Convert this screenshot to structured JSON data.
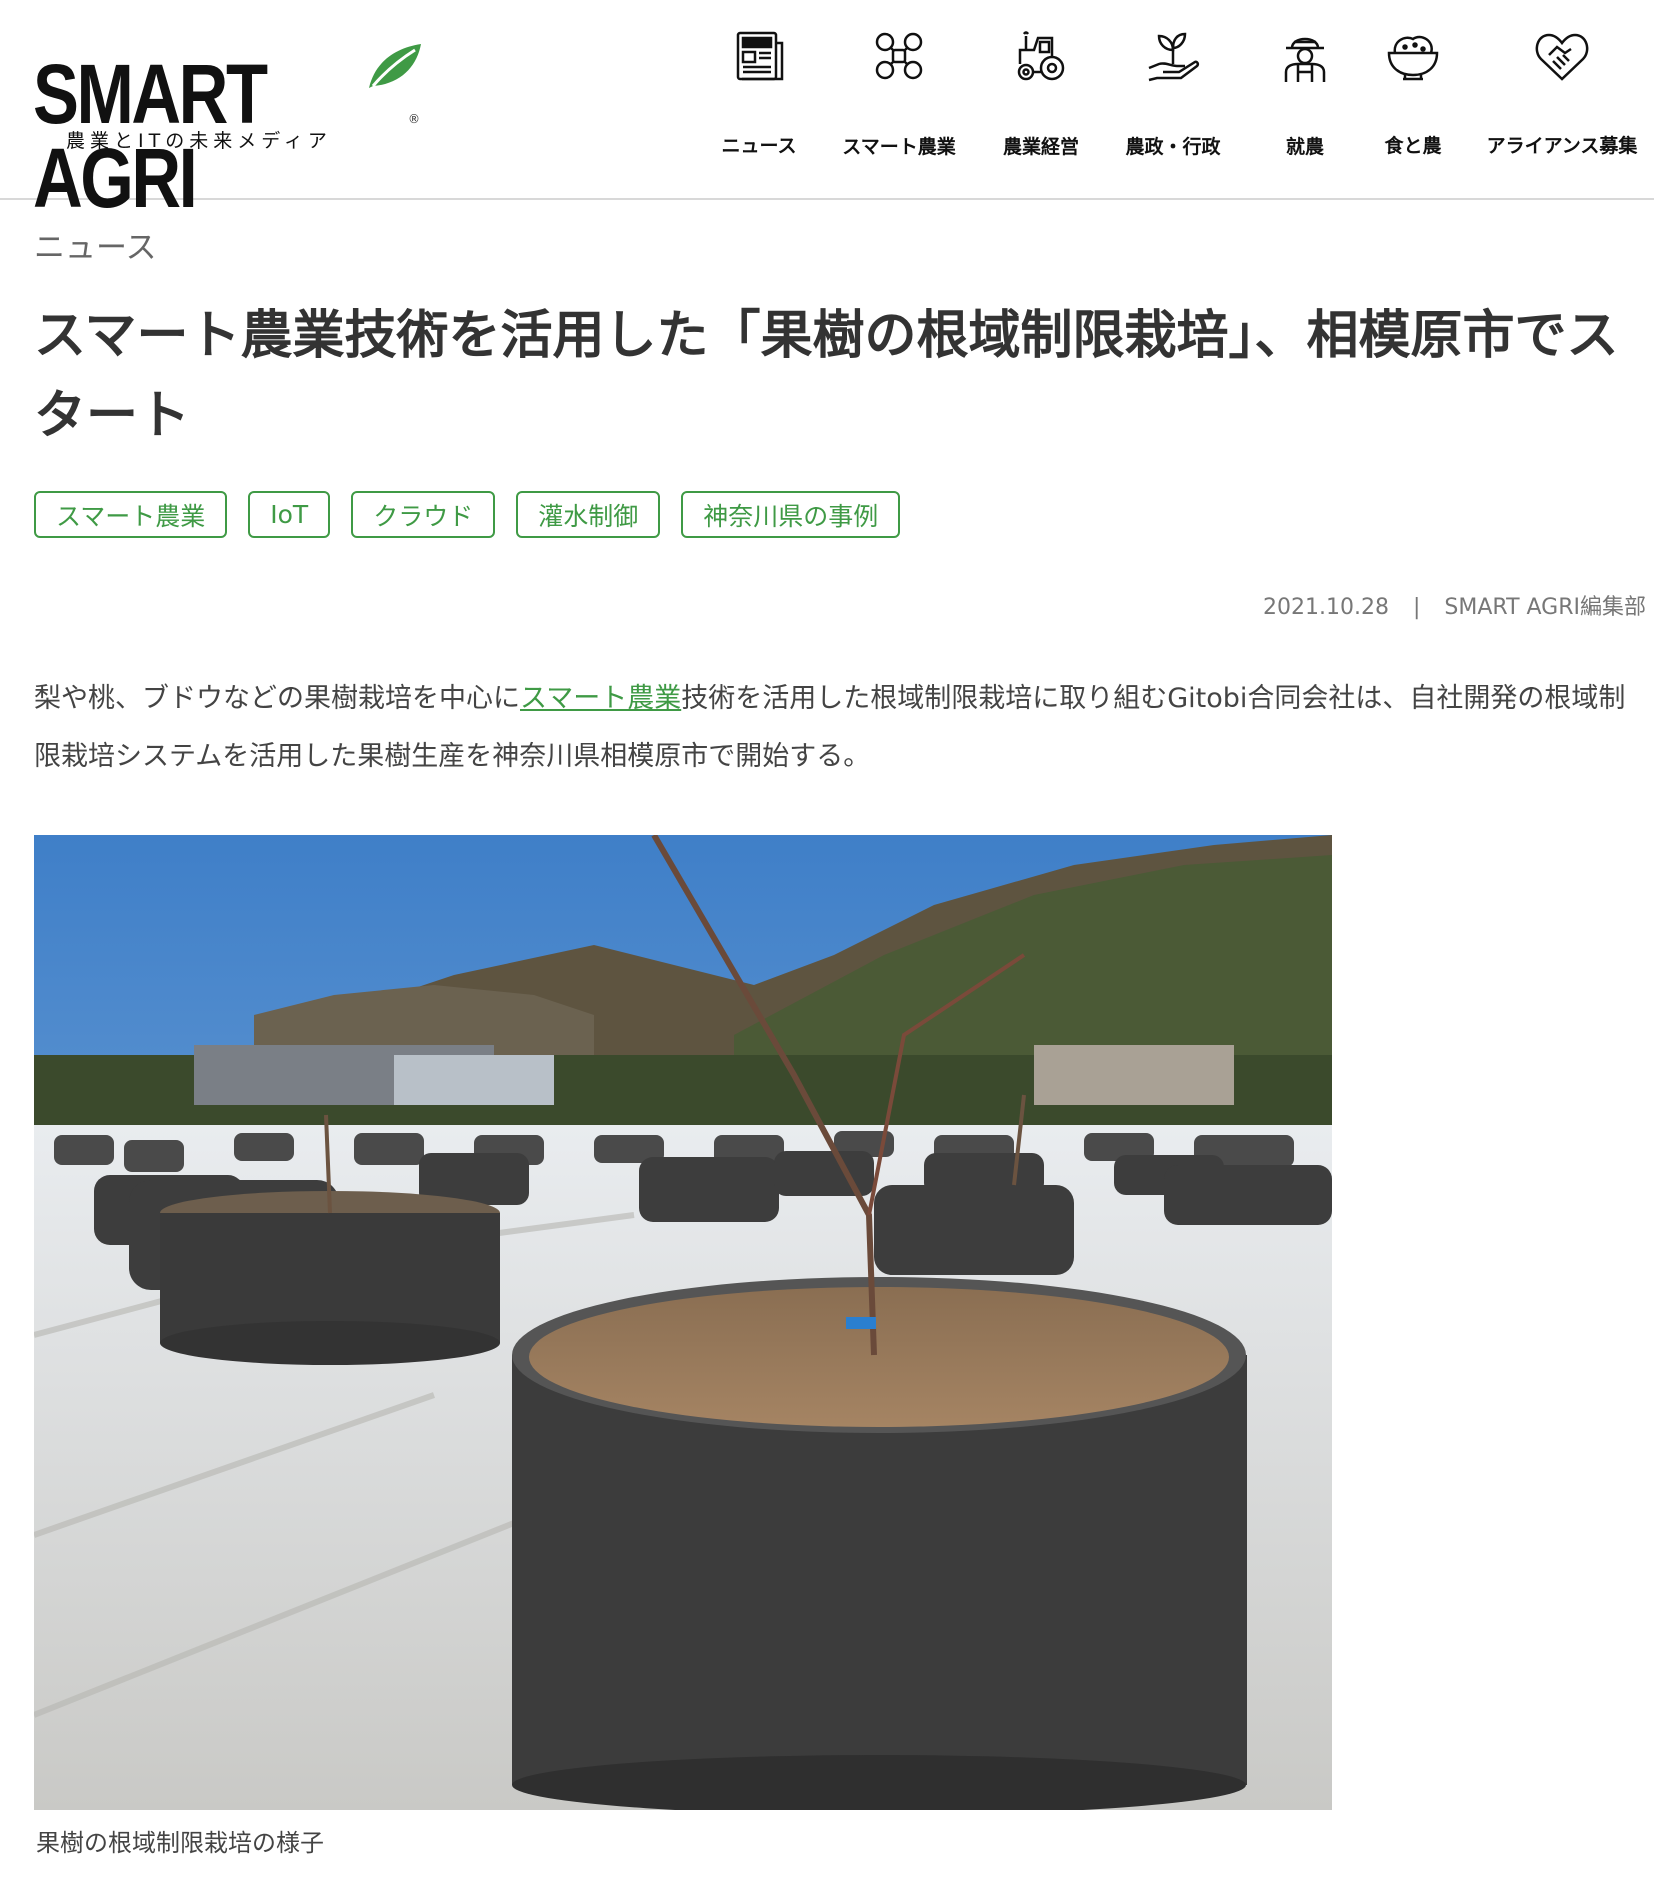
{
  "header": {
    "logo_main": "SMART AGRI",
    "logo_sub": "農業とITの未来メディア",
    "logo_reg": "®",
    "nav": [
      {
        "label": "ニュース",
        "icon": "newspaper-icon"
      },
      {
        "label": "スマート農業",
        "icon": "drone-icon"
      },
      {
        "label": "農業経営",
        "icon": "tractor-icon"
      },
      {
        "label": "農政・行政",
        "icon": "sprout-hand-icon"
      },
      {
        "label": "就農",
        "icon": "farmer-icon"
      },
      {
        "label": "食と農",
        "icon": "rice-bowl-icon"
      },
      {
        "label": "アライアンス募集",
        "icon": "handshake-heart-icon"
      }
    ]
  },
  "article": {
    "breadcrumb": "ニュース",
    "title": "スマート農業技術を活用した「果樹の根域制限栽培」、相模原市でスタート",
    "tags": [
      "スマート農業",
      "IoT",
      "クラウド",
      "灌水制御",
      "神奈川県の事例"
    ],
    "date": "2021.10.28",
    "separator": "|",
    "author": "SMART AGRI編集部",
    "lead_before": "梨や桃、ブドウなどの果樹栽培を中心に",
    "lead_link": "スマート農業",
    "lead_after": "技術を活用した根域制限栽培に取り組むGitobi合同会社は、自社開発の根域制限栽培システムを活用した果樹生産を神奈川県相模原市で開始する。",
    "photo_caption": "果樹の根域制限栽培の様子"
  },
  "colors": {
    "accent_green": "#3f9a45",
    "text": "#333333"
  }
}
